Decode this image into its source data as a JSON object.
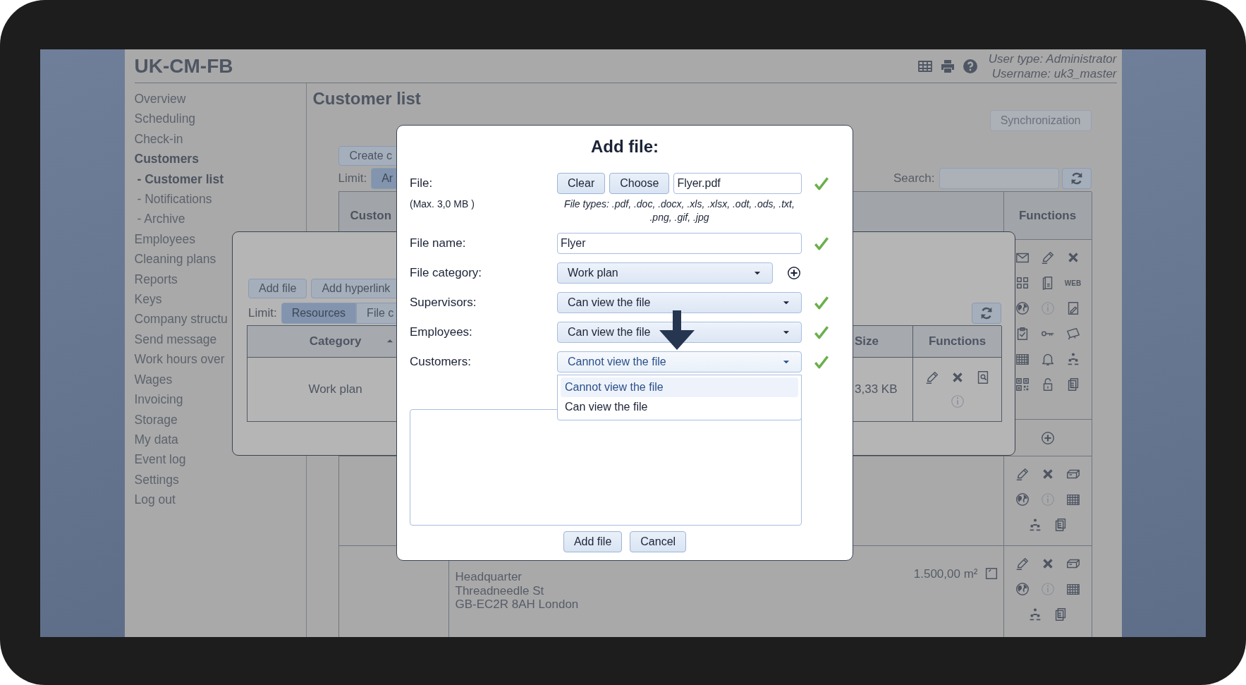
{
  "header": {
    "title": "UK-CM-FB",
    "user_type": "User type: Administrator",
    "username": "Username: uk3_master"
  },
  "sidebar": {
    "items": [
      {
        "label": "Overview",
        "selected": false
      },
      {
        "label": "Scheduling",
        "selected": false
      },
      {
        "label": "Check-in",
        "selected": false
      },
      {
        "label": "Customers",
        "selected": true,
        "children": [
          {
            "label": "- Customer list",
            "selected": true
          },
          {
            "label": "- Notifications",
            "selected": false
          },
          {
            "label": "- Archive",
            "selected": false
          }
        ]
      },
      {
        "label": "Employees",
        "selected": false
      },
      {
        "label": "Cleaning plans",
        "selected": false
      },
      {
        "label": "Reports",
        "selected": false
      },
      {
        "label": "Keys",
        "selected": false
      },
      {
        "label": "Company structu",
        "selected": false
      },
      {
        "label": "Send message",
        "selected": false
      },
      {
        "label": "Work hours over",
        "selected": false
      },
      {
        "label": "Wages",
        "selected": false
      },
      {
        "label": "Invoicing",
        "selected": false
      },
      {
        "label": "Storage",
        "selected": false
      },
      {
        "label": "My data",
        "selected": false
      },
      {
        "label": "Event log",
        "selected": false
      },
      {
        "label": "Settings",
        "selected": false
      },
      {
        "label": "Log out",
        "selected": false
      }
    ]
  },
  "page": {
    "title": "Customer list",
    "sync_button": {
      "label": "Synchronization",
      "disabled": true
    },
    "create_button": "Create c",
    "limit_label": "Limit:",
    "limit_segments": [
      {
        "label": "Ar",
        "selected": true
      }
    ],
    "search": {
      "label": "Search:"
    },
    "table": {
      "column_1": "Custon",
      "functions_column": "Functions",
      "web_label": "WEB",
      "rows": [
        {
          "address": [
            "Headquarter",
            "Threadneedle St",
            "GB-EC2R 8AH London"
          ],
          "area": "1.500,00 m²"
        }
      ]
    }
  },
  "files_dialog": {
    "buttons": [
      "Add file",
      "Add hyperlink"
    ],
    "limit_label": "Limit:",
    "segments": [
      {
        "label": "Resources",
        "selected": true
      },
      {
        "label": "File c",
        "selected": false
      }
    ],
    "columns": [
      {
        "label": "Category",
        "sorted": true
      },
      {
        "label": "Size"
      },
      {
        "label": "Functions"
      }
    ],
    "rows": [
      {
        "category": "Work plan",
        "size": "3,33 KB"
      }
    ]
  },
  "add_file_dialog": {
    "title": "Add file:",
    "file": {
      "label": "File:",
      "clear": "Clear",
      "choose": "Choose",
      "value": "Flyer.pdf",
      "valid": true
    },
    "max_note": "(Max. 3,0 MB )",
    "file_types": "File types: .pdf, .doc, .docx, .xls, .xlsx, .odt, .ods, .txt, .png, .gif, .jpg",
    "fields": [
      {
        "kind": "text",
        "label": "File name:",
        "value": "Flyer",
        "valid": true
      },
      {
        "kind": "select",
        "label": "File category:",
        "value": "Work plan",
        "valid": false,
        "add": true
      },
      {
        "kind": "select",
        "label": "Supervisors:",
        "value": "Can view the file",
        "valid": true
      },
      {
        "kind": "select",
        "label": "Employees:",
        "value": "Can view the file",
        "valid": true
      },
      {
        "kind": "select",
        "label": "Customers:",
        "value": "Cannot view the file",
        "valid": true,
        "open": true,
        "options": [
          {
            "label": "Cannot view the file",
            "selected": true
          },
          {
            "label": "Can view the file",
            "selected": false
          }
        ]
      }
    ],
    "buttons": [
      "Add file",
      "Cancel"
    ]
  }
}
